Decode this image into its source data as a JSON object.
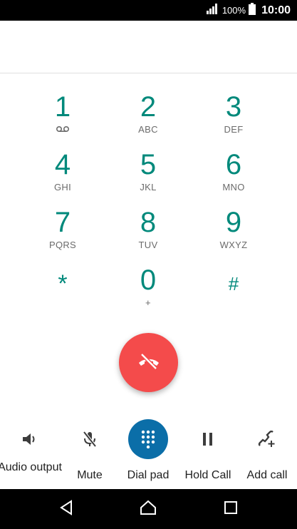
{
  "status_bar": {
    "battery_percent": "100%",
    "time": "10:00",
    "signal_icon": "signal-bars-icon",
    "battery_icon": "battery-icon"
  },
  "dialer": {
    "number": "",
    "keys": [
      {
        "digit": "1",
        "letters": "",
        "sub_icon": "voicemail-icon"
      },
      {
        "digit": "2",
        "letters": "ABC"
      },
      {
        "digit": "3",
        "letters": "DEF"
      },
      {
        "digit": "4",
        "letters": "GHI"
      },
      {
        "digit": "5",
        "letters": "JKL"
      },
      {
        "digit": "6",
        "letters": "MNO"
      },
      {
        "digit": "7",
        "letters": "PQRS"
      },
      {
        "digit": "8",
        "letters": "TUV"
      },
      {
        "digit": "9",
        "letters": "WXYZ"
      },
      {
        "digit": "*",
        "letters": ""
      },
      {
        "digit": "0",
        "letters": "+"
      },
      {
        "digit": "#",
        "letters": ""
      }
    ]
  },
  "end_call": {
    "icon": "end-call-icon",
    "color": "#f44b4b"
  },
  "controls": [
    {
      "label": "Audio output",
      "icon": "speaker-icon"
    },
    {
      "label": "Mute",
      "icon": "mic-off-icon"
    },
    {
      "label": "Dial pad",
      "icon": "dialpad-icon",
      "active": true
    },
    {
      "label": "Hold Call",
      "icon": "pause-icon"
    },
    {
      "label": "Add call",
      "icon": "add-call-icon"
    }
  ],
  "colors": {
    "accent": "#00897b",
    "active_control": "#0b6ea8"
  },
  "nav": {
    "back_icon": "back-icon",
    "home_icon": "home-icon",
    "recents_icon": "recents-icon"
  }
}
